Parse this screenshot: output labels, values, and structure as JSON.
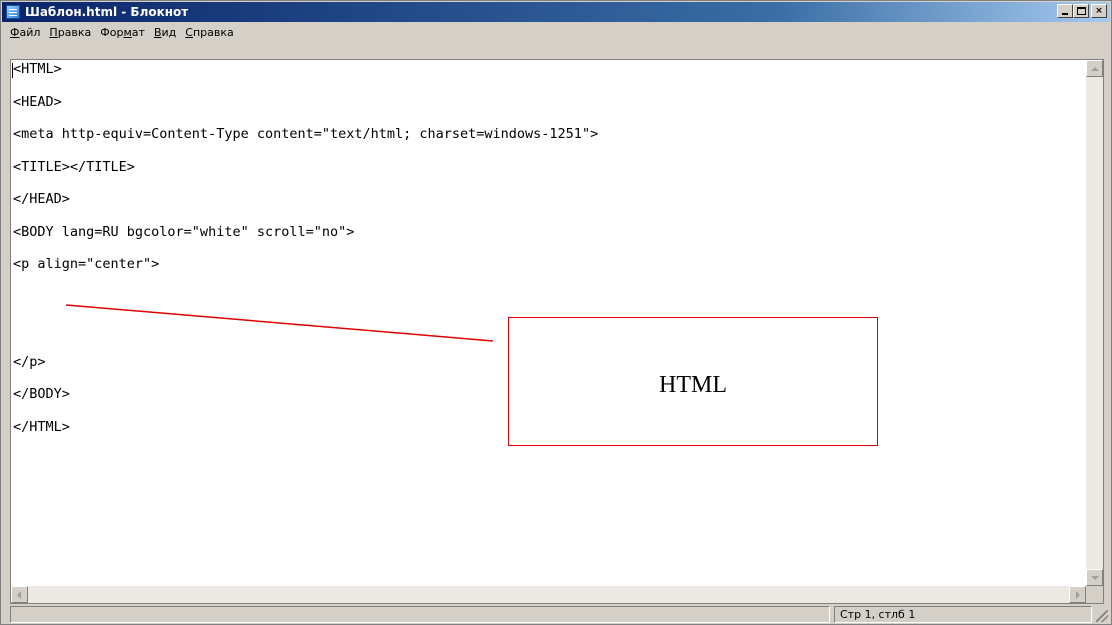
{
  "window": {
    "title": "Шаблон.html - Блокнот",
    "icon": "notepad-icon",
    "buttons": {
      "minimize": "minimize-icon",
      "maximize": "maximize-icon",
      "close": "×"
    }
  },
  "menu": [
    {
      "accel": "Ф",
      "rest": "айл"
    },
    {
      "accel": "П",
      "rest": "равка"
    },
    {
      "pre": "Фор",
      "accel": "м",
      "rest": "ат"
    },
    {
      "accel": "В",
      "rest": "ид"
    },
    {
      "accel": "С",
      "rest": "правка"
    }
  ],
  "code_lines": [
    "<HTML>",
    "<HEAD>",
    "<meta http-equiv=Content-Type content=\"text/html; charset=windows-1251\">",
    "<TITLE></TITLE>",
    "</HEAD>",
    "<BODY lang=RU bgcolor=\"white\" scroll=\"no\">",
    "<p align=\"center\">",
    "",
    "",
    "</p>",
    "</BODY>",
    "</HTML>"
  ],
  "status": {
    "position": "Стр 1, стлб 1"
  },
  "annotation": {
    "label": "HTML",
    "color": "#e00000"
  }
}
